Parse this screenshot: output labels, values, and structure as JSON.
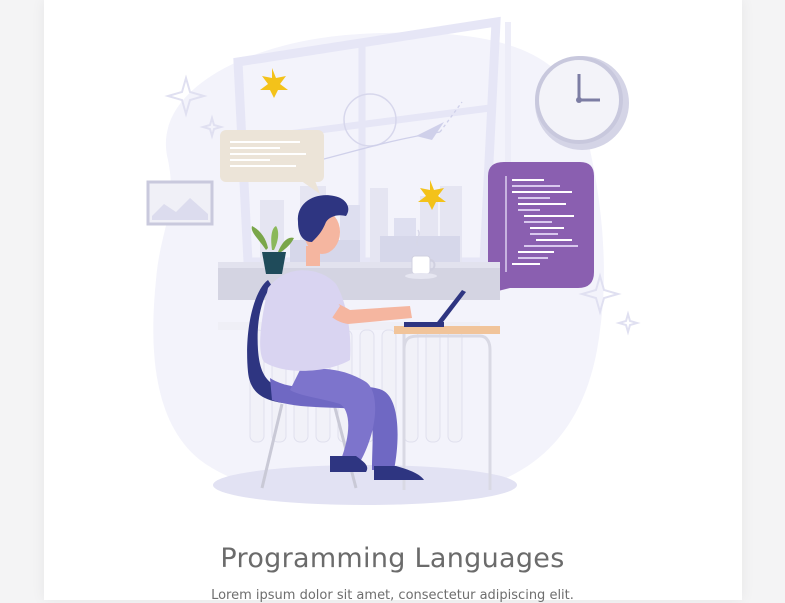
{
  "card": {
    "title": "Programming Languages",
    "description": "Lorem ipsum dolor sit amet, consectetur adipiscing elit."
  },
  "illustration": {
    "subject": "developer-at-laptop",
    "colors": {
      "primary": "#8b78c9",
      "dark": "#2e3581",
      "light": "#f2f2fb",
      "bubble_purple": "#8a5fb0",
      "bubble_beige": "#ece4d8",
      "leaf": "#f3c21a"
    }
  }
}
